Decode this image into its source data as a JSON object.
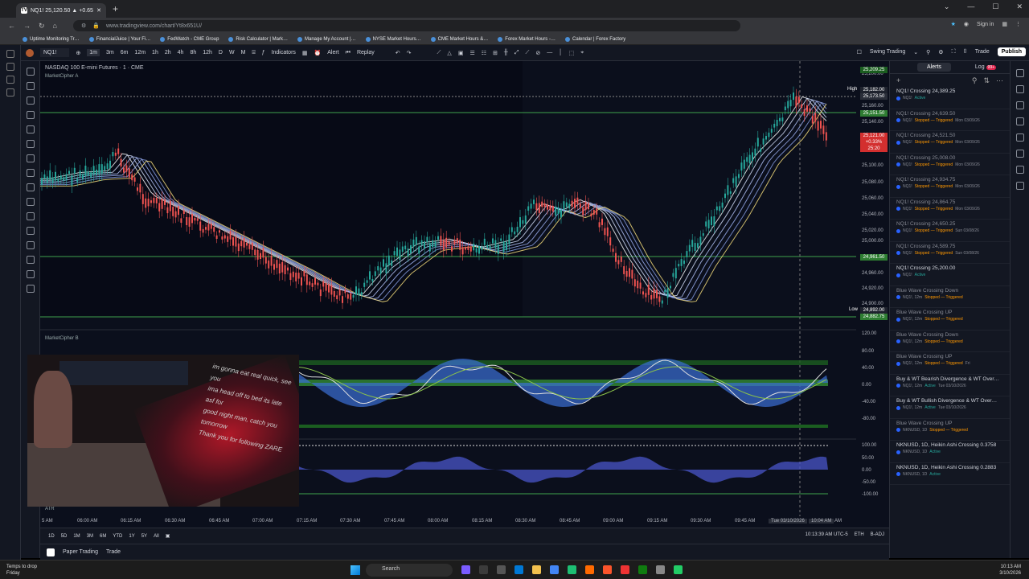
{
  "browser": {
    "tab_title": "NQ1! 25,120.50 ▲ +0.65% Swi…",
    "new_tab": "+",
    "url": "www.tradingview.com/chart/Yt8x651U/",
    "sign_in": "Sign in",
    "bookmarks": [
      "Uptime Monitoring Tr…",
      "FinancialJuice | Your Fi…",
      "FedWatch - CME Group",
      "Risk Calculator | Mark…",
      "Manage My Account |…",
      "NYSE Market Hours…",
      "CME Market Hours &…",
      "Forex Market Hours -…",
      "Calendar | Forex Factory"
    ]
  },
  "toolbar": {
    "symbol": "NQ1!",
    "timeframes": [
      "1m",
      "3m",
      "6m",
      "12m",
      "1h",
      "2h",
      "4h",
      "8h",
      "12h",
      "D",
      "W",
      "M"
    ],
    "indicators": "Indicators",
    "alert": "Alert",
    "replay": "Replay",
    "layout_name": "Swing Trading",
    "trade": "Trade",
    "publish": "Publish"
  },
  "chart": {
    "symbol_title": "NASDAQ 100 E-mini Futures · 1 · CME",
    "indicator_a": "MarketCipher A",
    "indicator_b": "MarketCipher B",
    "indicator_atr": "ATR",
    "price_axis": [
      "25,200.00",
      "25,160.00",
      "25,140.00",
      "25,100.00",
      "25,080.00",
      "25,060.00",
      "25,040.00",
      "25,020.00",
      "25,000.00",
      "24,980.00",
      "24,960.00",
      "24,940.00",
      "24,920.00",
      "24,900.00"
    ],
    "osc_axis": [
      "120.00",
      "80.00",
      "40.00",
      "0.00",
      "-40.00",
      "-80.00"
    ],
    "atr_axis": [
      "100.00",
      "50.00",
      "0.00",
      "-50.00",
      "-100.00"
    ],
    "high_label": "High",
    "low_label": "Low",
    "tags": {
      "t1": "25,209.25",
      "t2": "25,182.00",
      "t3": "25,173.50",
      "t4": "25,151.50",
      "t5": "25,121.00",
      "t5b": "+0.33%",
      "t5c": "25:20",
      "t6": "24,961.50",
      "t7": "24,892.00",
      "t8": "24,882.75"
    },
    "time_axis": [
      "5 AM",
      "06:00 AM",
      "06:15 AM",
      "06:30 AM",
      "06:45 AM",
      "07:00 AM",
      "07:15 AM",
      "07:30 AM",
      "07:45 AM",
      "08:00 AM",
      "08:15 AM",
      "08:30 AM",
      "08:45 AM",
      "09:00 AM",
      "09:15 AM",
      "09:30 AM",
      "09:45 AM",
      "Tue 03/10/2026",
      "10:04 AM",
      "AM"
    ],
    "ranges": [
      "1D",
      "5D",
      "1M",
      "3M",
      "6M",
      "YTD",
      "1Y",
      "5Y",
      "All"
    ],
    "clock": "10:13:39 AM UTC-5",
    "session": "ETH",
    "adj": "B-ADJ"
  },
  "bottom": {
    "paper": "Paper Trading",
    "trade": "Trade"
  },
  "webcam": {
    "chat": [
      "im gonna eat real quick, see you",
      "ima head off to bed its late asf for",
      "good night man, catch you tomorrow",
      "Thank you for following ZARE"
    ]
  },
  "alerts_panel": {
    "tab_alerts": "Alerts",
    "tab_log": "Log",
    "log_badge": "99+",
    "items": [
      {
        "title": "NQ1! Crossing 24,389.25",
        "sym": "NQ1!",
        "status": "Active",
        "time": "",
        "dim": false
      },
      {
        "title": "NQ1! Crossing 24,639.50",
        "sym": "NQ1!",
        "status": "Stopped — Triggered",
        "time": "Mon 03/09/26",
        "dim": true
      },
      {
        "title": "NQ1! Crossing 24,521.50",
        "sym": "NQ1!",
        "status": "Stopped — Triggered",
        "time": "Mon 03/09/26",
        "dim": true
      },
      {
        "title": "NQ1! Crossing 25,008.00",
        "sym": "NQ1!",
        "status": "Stopped — Triggered",
        "time": "Mon 03/09/26",
        "dim": true
      },
      {
        "title": "NQ1! Crossing 24,934.75",
        "sym": "NQ1!",
        "status": "Stopped — Triggered",
        "time": "Mon 03/09/26",
        "dim": true
      },
      {
        "title": "NQ1! Crossing 24,864.75",
        "sym": "NQ1!",
        "status": "Stopped — Triggered",
        "time": "Mon 03/09/26",
        "dim": true
      },
      {
        "title": "NQ1! Crossing 24,650.25",
        "sym": "NQ1!",
        "status": "Stopped — Triggered",
        "time": "Sun 03/08/26",
        "dim": true
      },
      {
        "title": "NQ1! Crossing 24,589.75",
        "sym": "NQ1!",
        "status": "Stopped — Triggered",
        "time": "Sun 03/08/26",
        "dim": true
      },
      {
        "title": "NQ1! Crossing 25,200.00",
        "sym": "NQ1!",
        "status": "Active",
        "time": "",
        "dim": false
      },
      {
        "title": "Blue Wave Crossing Down",
        "sym": "NQ1!, 12m",
        "status": "Stopped — Triggered",
        "time": "",
        "dim": true
      },
      {
        "title": "Blue Wave Crossing UP",
        "sym": "NQ1!, 12m",
        "status": "Stopped — Triggered",
        "time": "",
        "dim": true
      },
      {
        "title": "Blue Wave Crossing Down",
        "sym": "NQ1!, 12m",
        "status": "Stopped — Triggered",
        "time": "",
        "dim": true
      },
      {
        "title": "Blue Wave Crossing UP",
        "sym": "NQ1!, 12m",
        "status": "Stopped — Triggered",
        "time": "Fri",
        "dim": true
      },
      {
        "title": "Buy & WT Bearish Divergence & WT Over…",
        "sym": "NQ1!, 12m",
        "status": "Active",
        "time": "Tue 03/10/2026",
        "dim": false
      },
      {
        "title": "Buy & WT Bullish Divergence & WT Over…",
        "sym": "NQ1!, 12m",
        "status": "Active",
        "time": "Tue 03/10/2026",
        "dim": false
      },
      {
        "title": "Blue Wave Crossing UP",
        "sym": "NKNUSD, 1D",
        "status": "Stopped — Triggered",
        "time": "",
        "dim": true
      },
      {
        "title": "NKNUSD, 1D, Heikin Ashi Crossing 0.3758",
        "sym": "NKNUSD, 1D",
        "status": "Active",
        "time": "",
        "dim": false
      },
      {
        "title": "NKNUSD, 1D, Heikin Ashi Crossing 0.2883",
        "sym": "NKNUSD, 1D",
        "status": "Active",
        "time": "",
        "dim": false
      }
    ]
  },
  "taskbar": {
    "weather": "Temps to drop",
    "weather_day": "Friday",
    "search": "Search",
    "time": "10:13 AM",
    "date": "3/10/2026"
  }
}
